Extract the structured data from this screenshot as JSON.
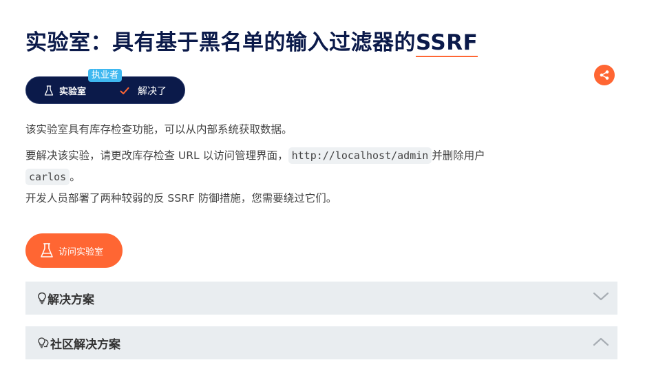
{
  "header": {
    "title_main": "实验室：具有基于黑名单的输入过滤器的",
    "title_ssrf": "SSRF"
  },
  "status": {
    "level_badge": "执业者",
    "lab_label": "实验室",
    "solved_label": "解决了",
    "solved_color": "#ff6633"
  },
  "description": {
    "p1": "该实验室具有库存检查功能，可以从内部系统获取数据。",
    "p2_before": "要解决该实验，请更改库存检查 URL 以访问管理界面，",
    "p2_code_url": "http://localhost/admin",
    "p2_middle": "并删除用户",
    "p2_code_user": "carlos",
    "p2_after": "。",
    "p3": "开发人员部署了两种较弱的反 SSRF 防御措施，您需要绕过它们。"
  },
  "actions": {
    "access_lab_label": "访问实验室",
    "share_icon": "share-icon"
  },
  "accordions": {
    "solution_label": "解决方案",
    "community_label": "社区解决方案"
  },
  "colors": {
    "accent": "#ff6633",
    "navy": "#0b1a4a",
    "badge": "#3fb8f0",
    "panel": "#e9edf0"
  }
}
